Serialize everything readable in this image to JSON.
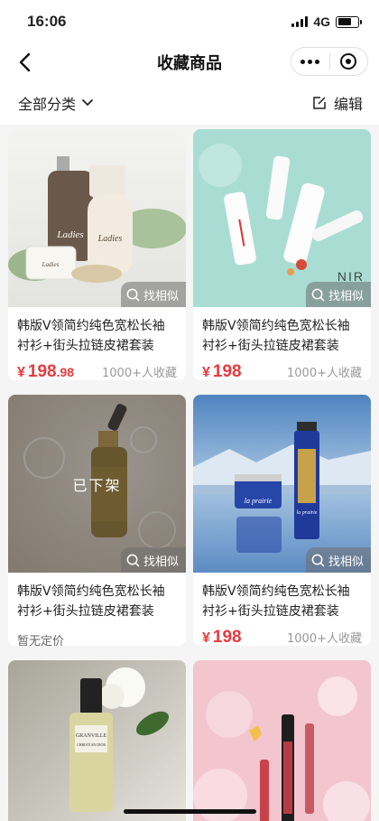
{
  "status": {
    "time": "16:06",
    "network": "4G"
  },
  "nav": {
    "title": "收藏商品"
  },
  "filter": {
    "label": "全部分类",
    "edit_label": "编辑"
  },
  "find_similar_label": "找相似",
  "items": [
    {
      "title": "韩版V领简约纯色宽松长袖衬衫+街头拉链皮裙套装",
      "currency": "¥",
      "price_int": "198",
      "price_dec": ".98",
      "favorites": "1000+人收藏",
      "image": "ladies-skincare-bottles"
    },
    {
      "title": "韩版V领简约纯色宽松长袖衬衫+街头拉链皮裙套装",
      "currency": "¥",
      "price_int": "198",
      "price_dec": "",
      "favorites": "1000+人收藏",
      "image": "white-skincare-set-mint"
    },
    {
      "title": "韩版V领简约纯色宽松长袖衬衫+街头拉链皮裙套装",
      "removed_label": "已下架",
      "no_price_label": "暂无定价",
      "image": "serum-dropper-bottle"
    },
    {
      "title": "韩版V领简约纯色宽松长袖衬衫+街头拉链皮裙套装",
      "currency": "¥",
      "price_int": "198",
      "price_dec": "",
      "favorites": "1000+人收藏",
      "image": "la-prairie-cream"
    },
    {
      "title": "",
      "image": "perfume-granville"
    },
    {
      "title": "",
      "image": "lipgloss-pink-flowers"
    }
  ],
  "product_image_text": {
    "ladies_brand": "Ladies",
    "nir": "NIR",
    "perfume_name": "GRANVILLE",
    "perfume_brand": "CHRISTIAN DIOR",
    "la_prairie": "la prairie"
  },
  "colors": {
    "price": "#e8393d",
    "mint_bg": "#a9ddd3",
    "sky_bg": "#6f9cc8",
    "pink_bg": "#f2c5cf"
  }
}
